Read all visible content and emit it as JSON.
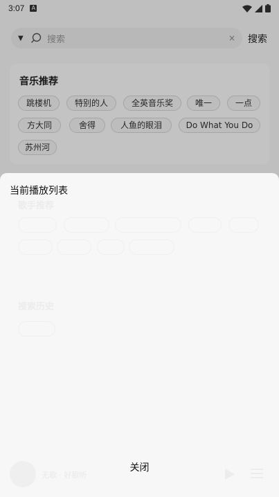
{
  "status_bar": {
    "time": "3:07",
    "notif_letter": "A"
  },
  "search": {
    "placeholder": "搜索",
    "clear": "×",
    "button": "搜索"
  },
  "recommend": {
    "title": "音乐推荐",
    "chips": [
      "跳楼机",
      "特别的人",
      "全英音乐奖",
      "唯一",
      "一点",
      "方大同",
      "舍得",
      "人鱼的眼泪",
      "Do What You Do",
      "苏州河"
    ]
  },
  "background_faint": {
    "singer_section_title": "歌手推荐",
    "history_title": "搜索历史",
    "history_item": "跳楼机",
    "player_text": "无歌 · 好歌听"
  },
  "playlist_sheet": {
    "title": "当前播放列表",
    "close": "关闭"
  },
  "icons": {
    "dropdown": "caret-down-icon",
    "search": "search-icon",
    "clear": "close-icon",
    "wifi": "wifi-icon",
    "signal": "signal-icon",
    "battery": "battery-icon"
  }
}
